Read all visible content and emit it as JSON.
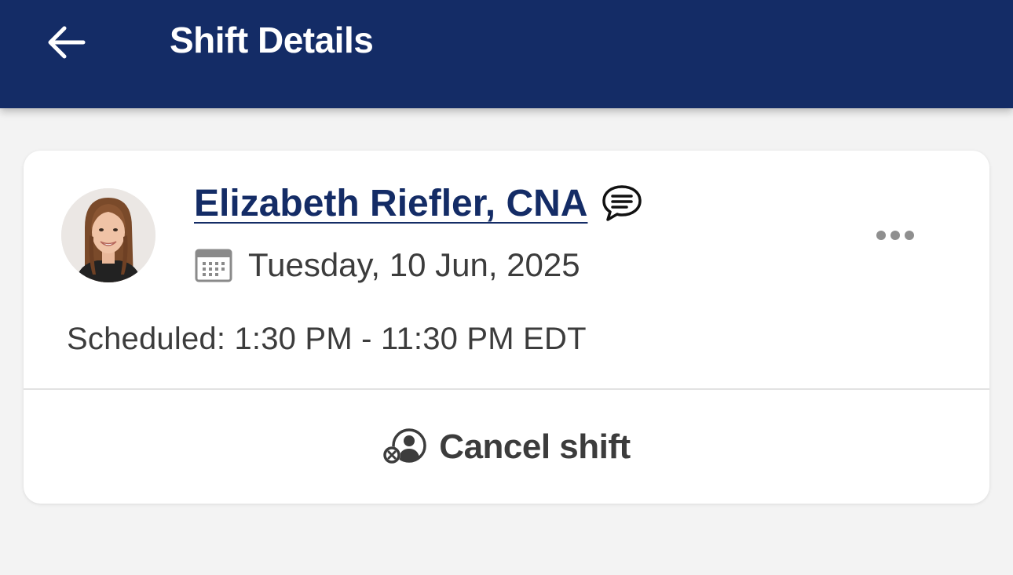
{
  "header": {
    "title": "Shift Details",
    "back_icon": "arrow-left-icon",
    "background_color": "#142c66"
  },
  "shift": {
    "worker_name": "Elizabeth Riefler, CNA",
    "message_icon": "chat-bubble-icon",
    "date_icon": "calendar-icon",
    "date": "Tuesday, 10 Jun, 2025",
    "more_icon": "more-horizontal-icon",
    "scheduled": "Scheduled: 1:30 PM - 11:30 PM EDT"
  },
  "actions": {
    "cancel_icon": "cancel-user-icon",
    "cancel_label": "Cancel shift"
  }
}
